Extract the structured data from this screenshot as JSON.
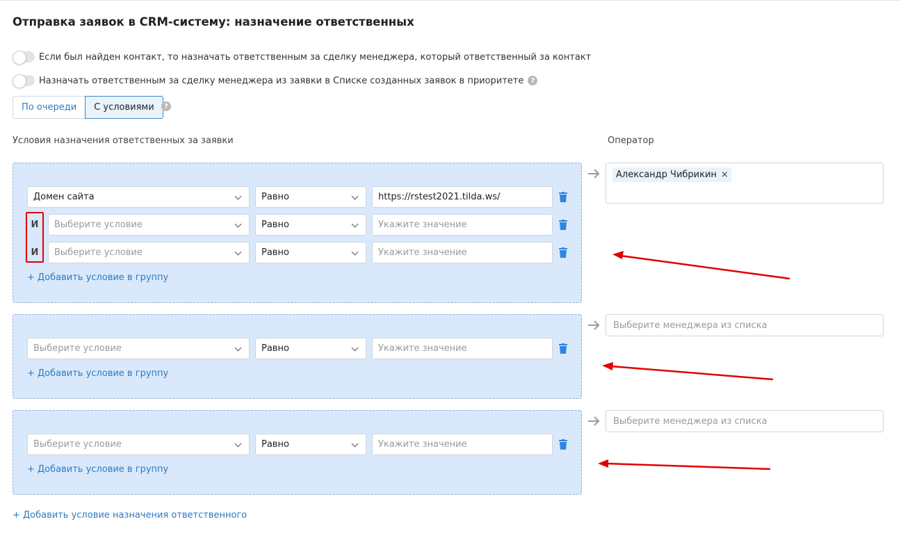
{
  "title": "Отправка заявок в CRM-систему: назначение ответственных",
  "toggles": [
    {
      "label": "Если был найден контакт, то назначать ответственным за сделку менеджера, который ответственный за контакт"
    },
    {
      "label": "Назначать ответственным за сделку менеджера из заявки в Списке созданных заявок в приоритете"
    }
  ],
  "help_glyph": "?",
  "segment": {
    "queue": "По очереди",
    "conditions": "С условиями",
    "selected": "С условиями"
  },
  "conditions_label": "Условия назначения ответственных за заявки",
  "operator_label": "Оператор",
  "and_label": "И",
  "add_condition_link": "+ Добавить условие в группу",
  "add_assignment_link": "+ Добавить условие назначения ответственного",
  "groups": [
    {
      "rows": [
        {
          "field": "Домен сайта",
          "operator": "Равно",
          "value": "https://rstest2021.tilda.ws/"
        },
        {
          "field": "Выберите условие",
          "operator": "Равно",
          "value": "Укажите значение"
        },
        {
          "field": "Выберите условие",
          "operator": "Равно",
          "value": "Укажите значение"
        }
      ],
      "assignee_tag": "Александр Чибрикин",
      "tag_remove": "×"
    },
    {
      "rows": [
        {
          "field": "Выберите условие",
          "operator": "Равно",
          "value": "Укажите значение"
        }
      ],
      "assignee_placeholder": "Выберите менеджера из списка"
    },
    {
      "rows": [
        {
          "field": "Выберите условие",
          "operator": "Равно",
          "value": "Укажите значение"
        }
      ],
      "assignee_placeholder": "Выберите менеджера из списка"
    }
  ],
  "colors": {
    "link": "#2b7bc2",
    "group_bg": "#d9e8fb",
    "annotation_red": "#e00000",
    "trash": "#2f86e0"
  },
  "icons": {
    "trash": "trash-icon",
    "arrow": "arrow-right-icon",
    "chevron": "chevron-down-icon",
    "help": "help-icon"
  }
}
